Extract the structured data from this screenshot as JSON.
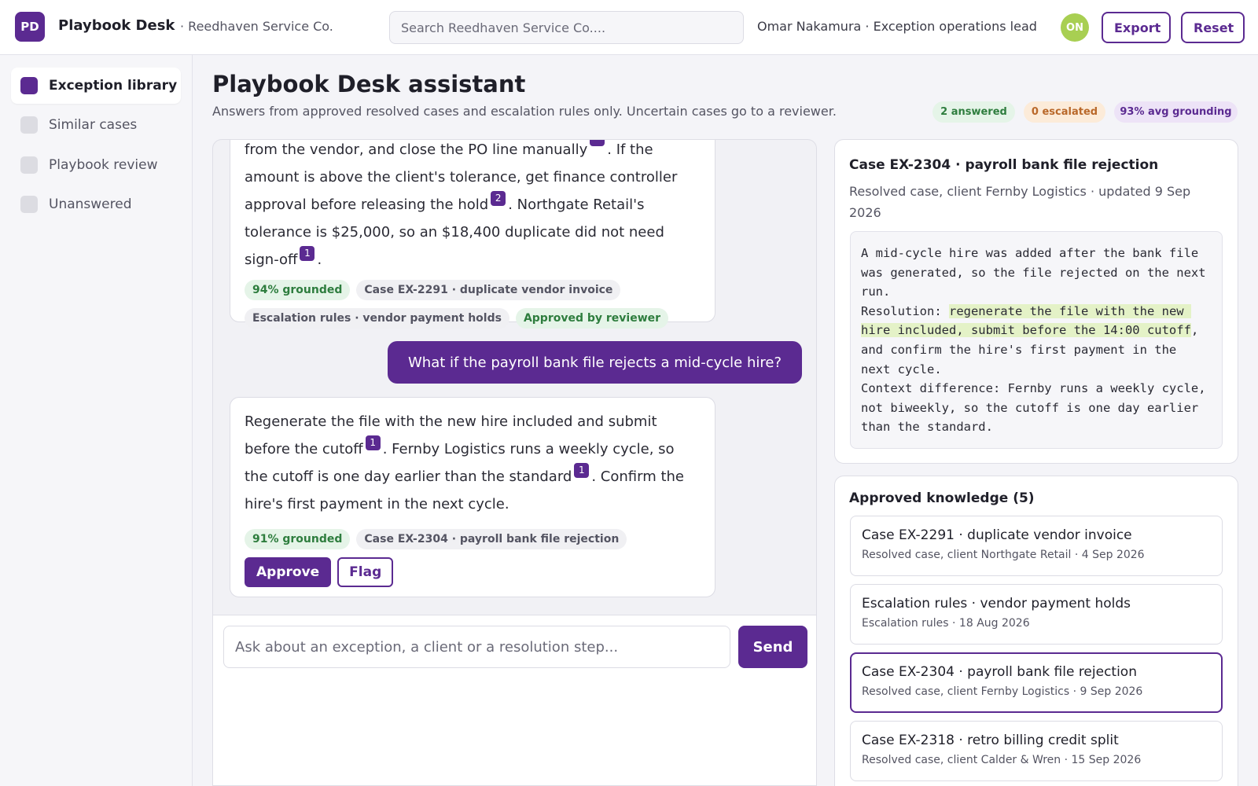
{
  "topbar": {
    "logo": "PD",
    "app_name": "Playbook Desk",
    "org": "· Reedhaven Service Co.",
    "search_placeholder": "Search Reedhaven Service Co....",
    "user": "Omar Nakamura · Exception operations lead",
    "avatar": "ON",
    "export_label": "Export",
    "reset_label": "Reset"
  },
  "sidebar": {
    "items": [
      {
        "label": "Exception library",
        "active": true
      },
      {
        "label": "Similar cases",
        "active": false
      },
      {
        "label": "Playbook review",
        "active": false
      },
      {
        "label": "Unanswered",
        "active": false
      }
    ]
  },
  "main": {
    "title": "Playbook Desk assistant",
    "subtitle": "Answers from approved resolved cases and escalation rules only. Uncertain cases go to a reviewer.",
    "stats": {
      "answered": "2 answered",
      "escalated": "0 escalated",
      "grounding": "93% avg grounding"
    }
  },
  "chat": {
    "answer1": {
      "part1": "from the vendor, and close the PO line manually",
      "part2": ". If the amount is above the client's tolerance, get finance controller approval before releasing the hold",
      "cite2": "2",
      "part3": ". Northgate Retail's tolerance is $25,000, so an $18,400 duplicate did not need sign-off",
      "cite3": "1",
      "part4": ".",
      "tags": [
        "94% grounded",
        "Case EX-2291 · duplicate vendor invoice",
        "Escalation rules · vendor payment holds",
        "Approved by reviewer"
      ]
    },
    "question": "What if the payroll bank file rejects a mid-cycle hire?",
    "answer2": {
      "part1": "Regenerate the file with the new hire included and submit before the cutoff",
      "cite1": "1",
      "part2": ". Fernby Logistics runs a weekly cycle, so the cutoff is one day earlier than the standard",
      "cite2": "1",
      "part3": ". Confirm the hire's first payment in the next cycle.",
      "tags": [
        "91% grounded",
        "Case EX-2304 · payroll bank file rejection"
      ],
      "approve_label": "Approve",
      "flag_label": "Flag"
    },
    "input_placeholder": "Ask about an exception, a client or a resolution step...",
    "send_label": "Send"
  },
  "case": {
    "title": "Case EX-2304 · payroll bank file rejection",
    "meta": "Resolved case, client Fernby Logistics · updated 9 Sep 2026",
    "body_intro": "A mid-cycle hire was added after the bank file was generated, so the file rejected on the next run.",
    "resolution_label": "Resolution: ",
    "resolution_highlight": "regenerate the file with the new hire included, submit before the 14:00 cutoff",
    "resolution_rest": ", and confirm the hire's first payment in the next cycle.",
    "context": "Context difference: Fernby runs a weekly cycle, not biweekly, so the cutoff is one day earlier than the standard."
  },
  "knowledge": {
    "title": "Approved knowledge (5)",
    "items": [
      {
        "name": "Case EX-2291 · duplicate vendor invoice",
        "meta": "Resolved case, client Northgate Retail · 4 Sep 2026",
        "selected": false
      },
      {
        "name": "Escalation rules · vendor payment holds",
        "meta": "Escalation rules · 18 Aug 2026",
        "selected": false
      },
      {
        "name": "Case EX-2304 · payroll bank file rejection",
        "meta": "Resolved case, client Fernby Logistics · 9 Sep 2026",
        "selected": true
      },
      {
        "name": "Case EX-2318 · retro billing credit split",
        "meta": "Resolved case, client Calder & Wren · 15 Sep 2026",
        "selected": false
      }
    ]
  },
  "colors": {
    "accent": "#5b2a91",
    "avatar": "#a8cf52",
    "grounded": "#2e7d3e",
    "escalated": "#b9682a",
    "highlight": "#e4f2c7"
  }
}
